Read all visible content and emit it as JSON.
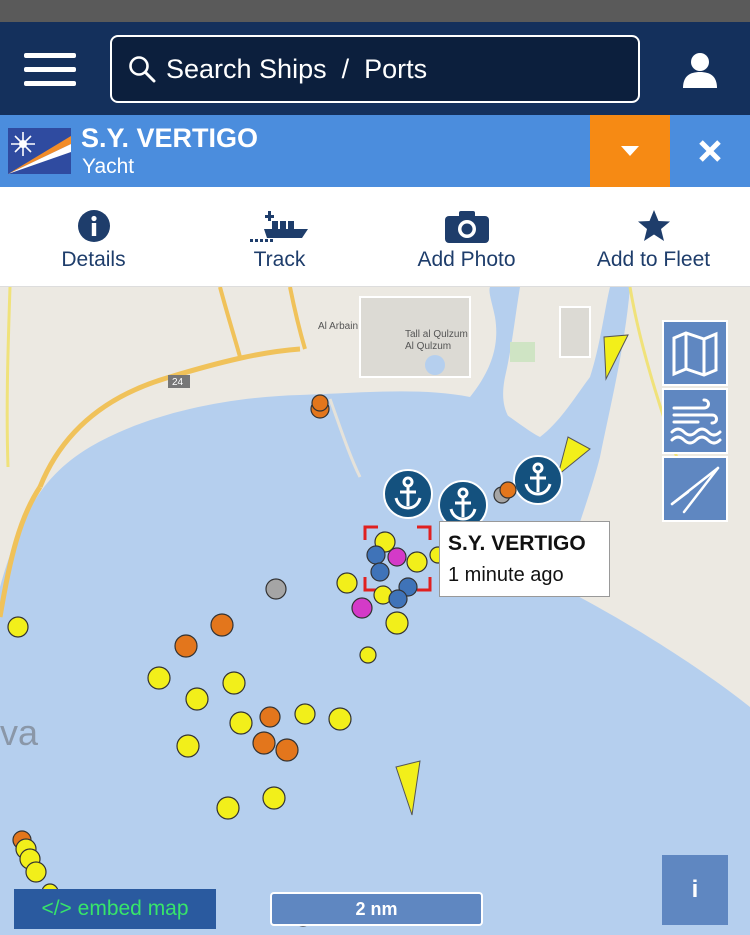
{
  "header": {
    "search_placeholder": "Search Ships  /  Ports"
  },
  "vessel": {
    "name": "S.Y. VERTIGO",
    "type": "Yacht"
  },
  "actions": [
    {
      "label": "Details",
      "icon": "info-icon"
    },
    {
      "label": "Track",
      "icon": "ship-track-icon"
    },
    {
      "label": "Add Photo",
      "icon": "camera-icon"
    },
    {
      "label": "Add to Fleet",
      "icon": "star-icon"
    }
  ],
  "map": {
    "place_labels": [
      "Al Arbain",
      "Tall al Qulzum",
      "Al Qulzum",
      "24",
      "va"
    ],
    "tooltip": {
      "title": "S.Y. VERTIGO",
      "time": "1 minute ago"
    },
    "embed_label": "</> embed map",
    "scale_label": "2 nm",
    "info_label": "i",
    "colors": {
      "water": "#b5cfee",
      "land": "#ece9e2",
      "accent_blue": "#14305c",
      "ship_bar": "#4b8ddd",
      "orange": "#f68a14",
      "vessel_yellow": "#f2ef1a",
      "vessel_orange": "#e3761c",
      "vessel_magenta": "#d43ac8",
      "vessel_blue": "#3f73b8",
      "vessel_gray": "#a5a5a5"
    }
  }
}
